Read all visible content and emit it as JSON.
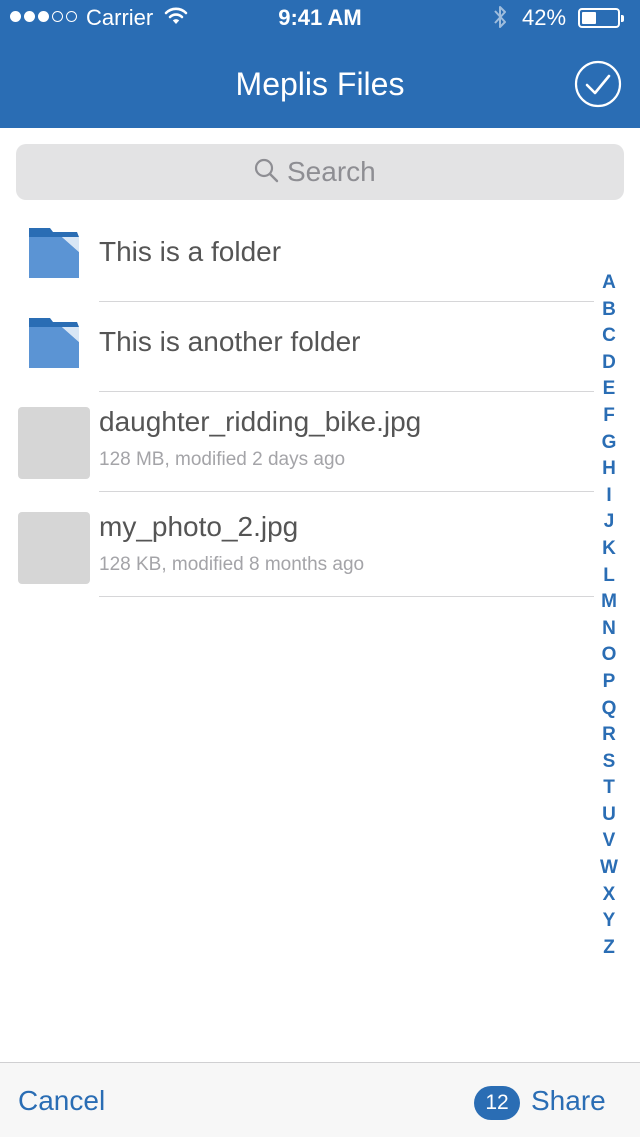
{
  "status_bar": {
    "carrier": "Carrier",
    "time": "9:41 AM",
    "battery_percent": "42%",
    "battery_level": 0.42,
    "signal_bars": 3,
    "signal_total": 5
  },
  "nav": {
    "title": "Meplis Files",
    "done_icon": "checkmark-circle-icon"
  },
  "search": {
    "placeholder": "Search",
    "value": ""
  },
  "files": [
    {
      "kind": "folder",
      "name": "This is a folder"
    },
    {
      "kind": "folder",
      "name": "This is another folder"
    },
    {
      "kind": "file",
      "name": "daughter_ridding_bike.jpg",
      "meta": "128 MB, modified 2 days ago"
    },
    {
      "kind": "file",
      "name": "my_photo_2.jpg",
      "meta": "128 KB, modified 8 months ago"
    }
  ],
  "index_letters": [
    "A",
    "B",
    "C",
    "D",
    "E",
    "F",
    "G",
    "H",
    "I",
    "J",
    "K",
    "L",
    "M",
    "N",
    "O",
    "P",
    "Q",
    "R",
    "S",
    "T",
    "U",
    "V",
    "W",
    "X",
    "Y",
    "Z"
  ],
  "toolbar": {
    "cancel_label": "Cancel",
    "share_count": "12",
    "share_label": "Share"
  },
  "colors": {
    "accent": "#2a6db4",
    "folder": "#5b94d4",
    "folder_dark": "#2a6db4",
    "thumb_placeholder": "#d6d6d6"
  }
}
